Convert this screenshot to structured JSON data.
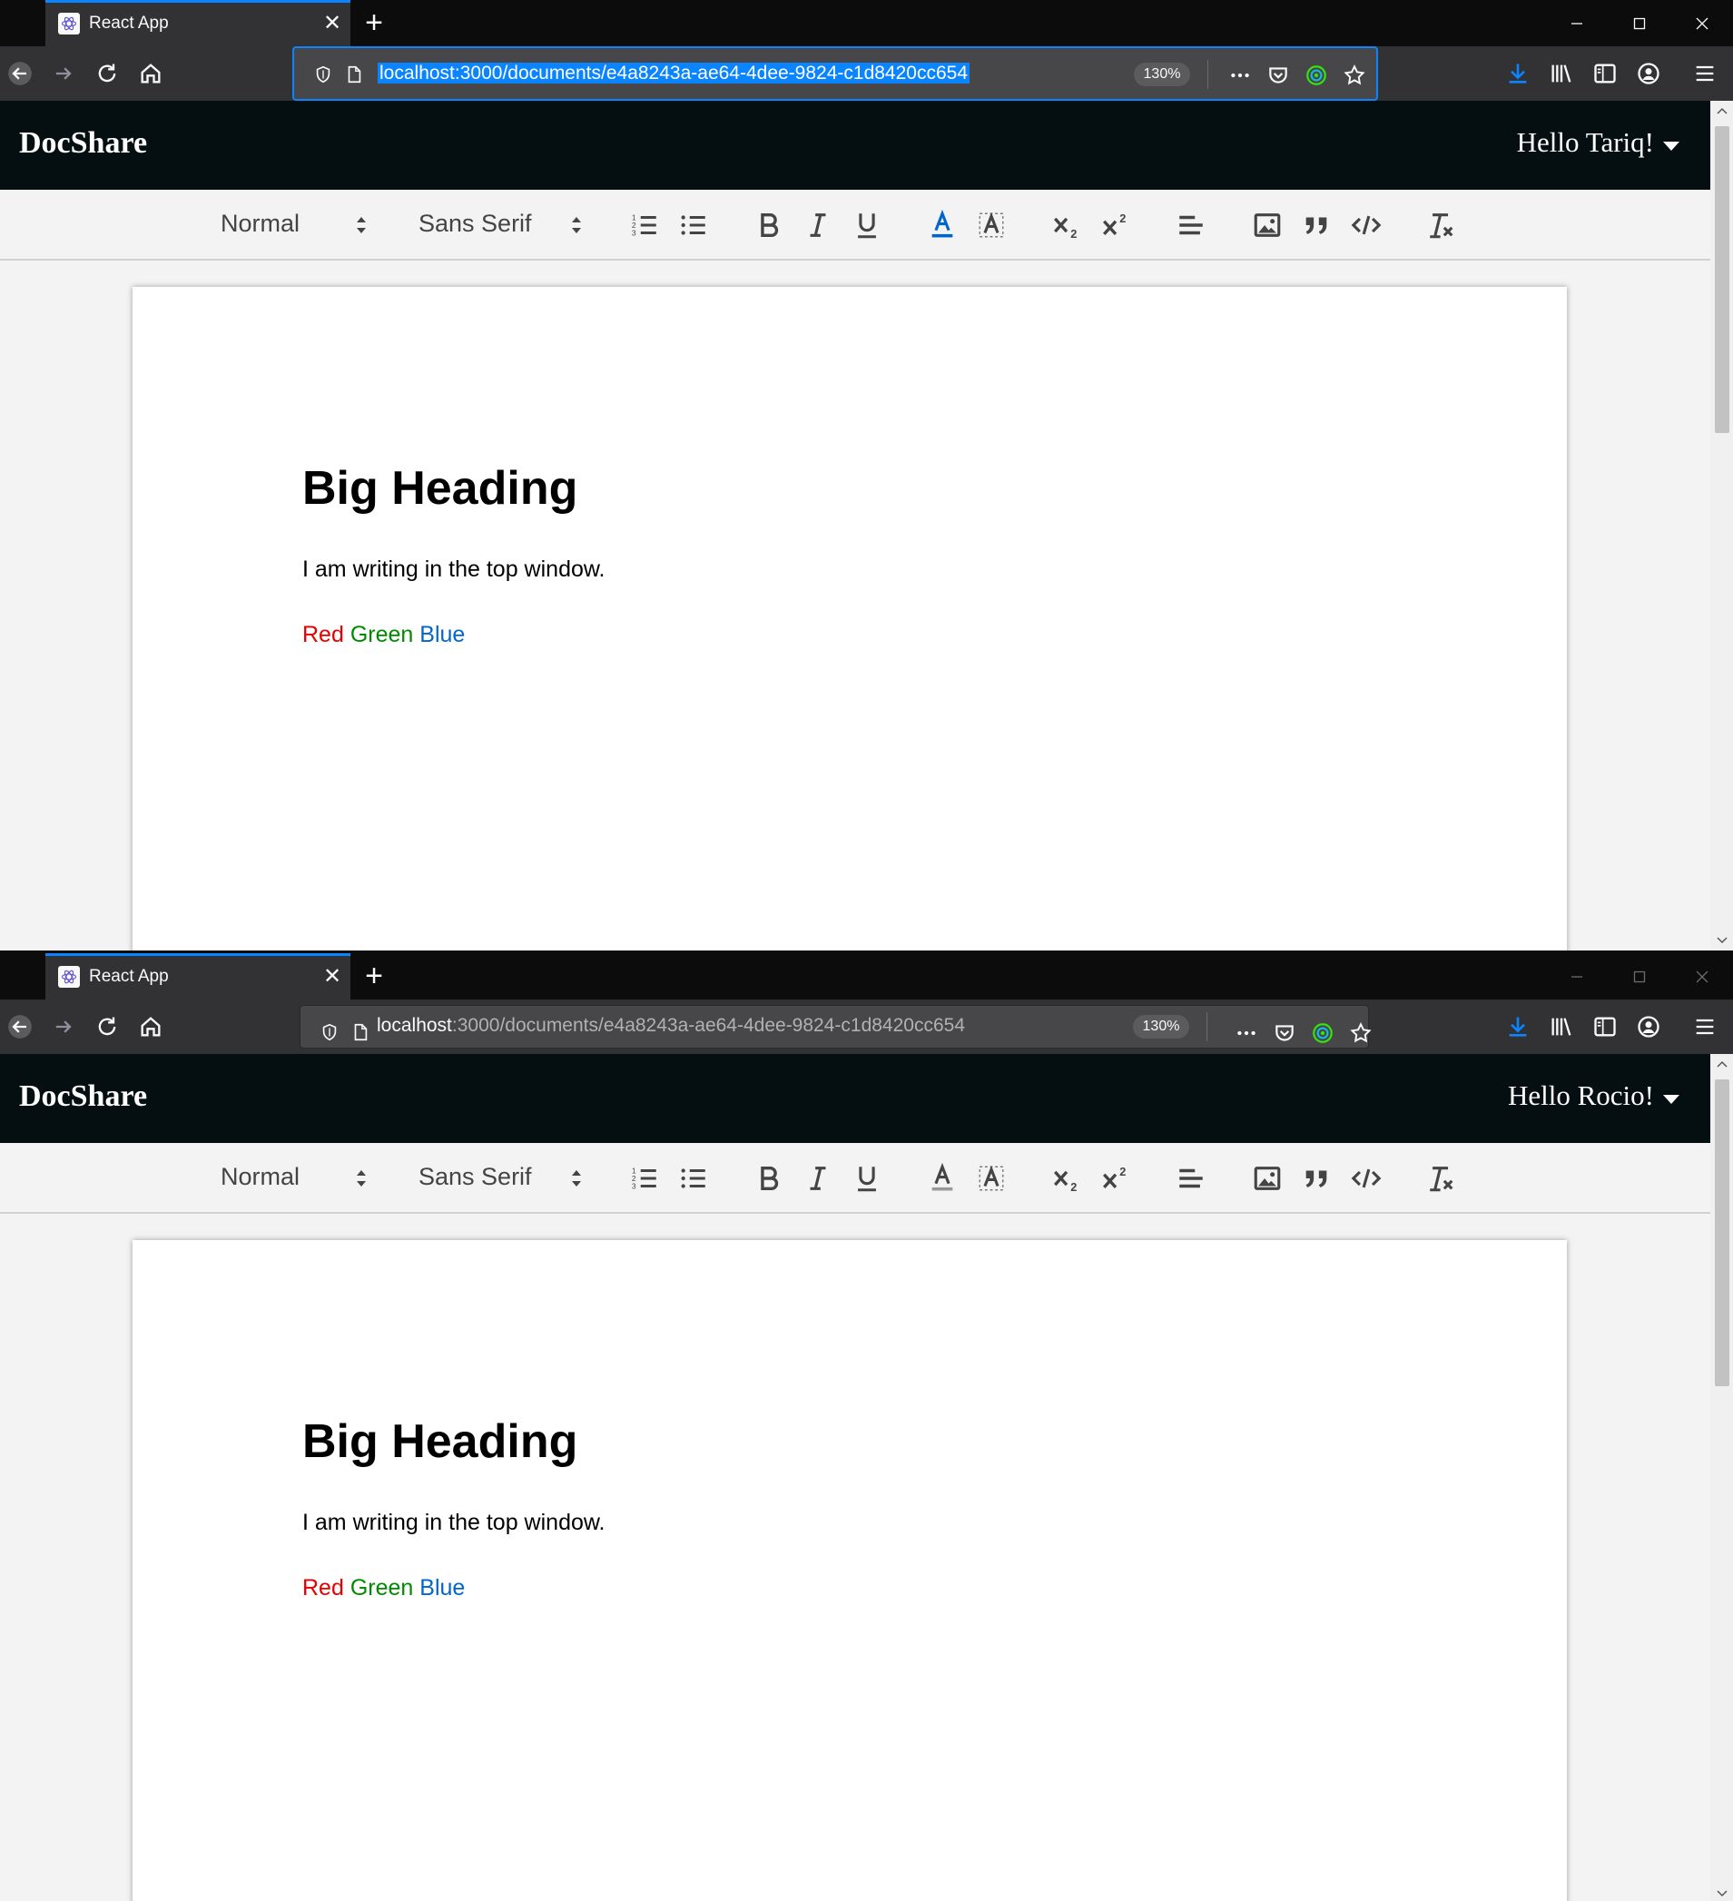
{
  "windows": [
    {
      "tab": {
        "title": "React App",
        "close": "✕"
      },
      "new_tab": "+",
      "url": {
        "host": "localhost",
        "rest": ":3000/documents/e4a8243a-ae64-4dee-9824-c1d8420cc654",
        "full": "localhost:3000/documents/e4a8243a-ae64-4dee-9824-c1d8420cc654",
        "selected": true
      },
      "zoom": "130%",
      "app": {
        "brand": "DocShare",
        "greeting": "Hello Tariq!"
      },
      "toolbar": {
        "header_picker": "Normal",
        "font_picker": "Sans Serif"
      },
      "doc": {
        "heading": "Big Heading",
        "paragraph": "I am writing in the top window.",
        "red": "Red",
        "green": "Green",
        "blue": "Blue"
      }
    },
    {
      "tab": {
        "title": "React App",
        "close": "✕"
      },
      "new_tab": "+",
      "url": {
        "host": "localhost",
        "rest": ":3000/documents/e4a8243a-ae64-4dee-9824-c1d8420cc654",
        "full": "localhost:3000/documents/e4a8243a-ae64-4dee-9824-c1d8420cc654",
        "selected": false
      },
      "zoom": "130%",
      "app": {
        "brand": "DocShare",
        "greeting": "Hello Rocio!"
      },
      "toolbar": {
        "header_picker": "Normal",
        "font_picker": "Sans Serif"
      },
      "doc": {
        "heading": "Big Heading",
        "paragraph": "I am writing in the top window.",
        "red": "Red",
        "green": "Green",
        "blue": "Blue"
      }
    }
  ],
  "colors": {
    "red": "#e60000",
    "green": "#008a00",
    "blue": "#0066cc",
    "accent": "#0a84ff",
    "app_header_bg": "#050f11"
  },
  "icons": {
    "toolbar": [
      "ordered-list-icon",
      "bullet-list-icon",
      "bold-icon",
      "italic-icon",
      "underline-icon",
      "text-color-icon",
      "background-color-icon",
      "subscript-icon",
      "superscript-icon",
      "align-icon",
      "image-icon",
      "blockquote-icon",
      "code-block-icon",
      "clear-format-icon"
    ],
    "browser": [
      "back-icon",
      "forward-icon",
      "reload-icon",
      "home-icon",
      "shield-icon",
      "page-icon",
      "more-icon",
      "pocket-icon",
      "extension-icon",
      "bookmark-star-icon",
      "download-icon",
      "library-icon",
      "sidebar-icon",
      "account-icon",
      "menu-icon"
    ]
  }
}
